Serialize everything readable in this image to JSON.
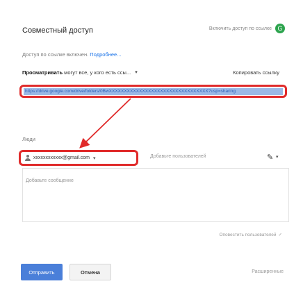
{
  "dialog": {
    "title": "Совместный доступ",
    "share_top_text": "Включить доступ по ссылке",
    "share_top_icon": "G",
    "access_text": "Доступ по ссылке включен.",
    "access_link": "Подробнее...",
    "permission_prefix": "Просматривать",
    "permission_rest": "могут все, у кого есть ссы...",
    "permission_caret": "▾",
    "copy_link": "Копировать ссылку",
    "link_url": "https://drive.google.com/drive/folders/0BwXXXXXXXXXXXXXXXXXXXXXXXXXXXXXXXXX?usp=sharing",
    "people_label": "Люди",
    "recipient_chip": "xxxxxxxxxxxx@gmail.com",
    "recipient_chevron": "▾",
    "add_more_placeholder": "Добавьте пользователей",
    "pencil_glyph": "✎",
    "pencil_caret": "▾",
    "message_placeholder": "Добавьте сообщение",
    "notify_text": "Оповестить пользователей",
    "notify_icon": "✓",
    "send_button": "Отправить",
    "cancel_button": "Отмена",
    "advanced_link": "Расширенные"
  }
}
